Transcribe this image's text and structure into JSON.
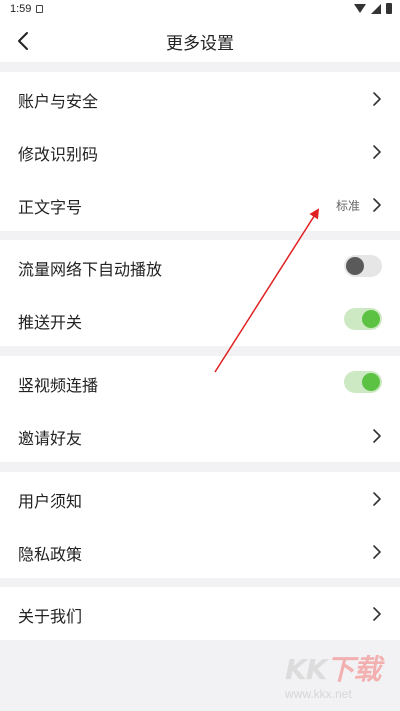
{
  "status_bar": {
    "time": "1:59"
  },
  "header": {
    "title": "更多设置",
    "back_icon": "chevron-left-icon"
  },
  "groups": [
    {
      "items": [
        {
          "label": "账户与安全",
          "type": "link"
        },
        {
          "label": "修改识别码",
          "type": "link"
        },
        {
          "label": "正文字号",
          "type": "link",
          "value": "标准"
        }
      ]
    },
    {
      "items": [
        {
          "label": "流量网络下自动播放",
          "type": "toggle",
          "on": false
        },
        {
          "label": "推送开关",
          "type": "toggle",
          "on": true
        }
      ]
    },
    {
      "items": [
        {
          "label": "竖视频连播",
          "type": "toggle",
          "on": true
        },
        {
          "label": "邀请好友",
          "type": "link"
        }
      ]
    },
    {
      "items": [
        {
          "label": "用户须知",
          "type": "link"
        },
        {
          "label": "隐私政策",
          "type": "link"
        }
      ]
    },
    {
      "items": [
        {
          "label": "关于我们",
          "type": "link"
        }
      ]
    }
  ],
  "watermark": {
    "logo": "KK下载",
    "url": "www.kkx.net"
  },
  "colors": {
    "background": "#f2f2f4",
    "toggle_on_track": "#cde9c3",
    "toggle_on_knob": "#5cc244",
    "toggle_off_track": "#e6e6e6",
    "toggle_off_knob": "#5a5a5a",
    "annotation_arrow": "#e02020"
  }
}
